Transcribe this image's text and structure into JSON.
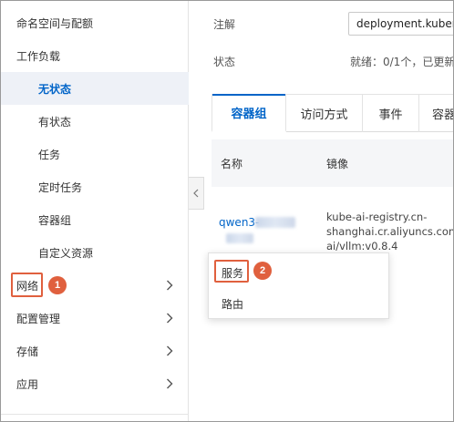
{
  "sidebar": {
    "items": [
      {
        "label": "命名空间与配额"
      },
      {
        "label": "工作负载"
      },
      {
        "label": "无状态"
      },
      {
        "label": "有状态"
      },
      {
        "label": "任务"
      },
      {
        "label": "定时任务"
      },
      {
        "label": "容器组"
      },
      {
        "label": "自定义资源"
      },
      {
        "label": "网络"
      },
      {
        "label": "配置管理"
      },
      {
        "label": "存储"
      },
      {
        "label": "应用"
      }
    ]
  },
  "steps": {
    "network": "1",
    "service": "2"
  },
  "details": {
    "annotation_label": "注解",
    "annotation_value": "deployment.kubernetes",
    "status_label": "状态",
    "status_value": "就绪：0/1个，已更新：1个"
  },
  "tabs": [
    {
      "label": "容器组"
    },
    {
      "label": "访问方式"
    },
    {
      "label": "事件"
    },
    {
      "label": "容器"
    }
  ],
  "table": {
    "headers": {
      "name": "名称",
      "image": "镜像"
    },
    "rows": [
      {
        "name": "qwen3-",
        "image": "kube-ai-registry.cn-shanghai.cr.aliyuncs.com/kube-ai/vllm:v0.8.4"
      }
    ]
  },
  "popup_menu": {
    "items": [
      {
        "label": "服务"
      },
      {
        "label": "路由"
      }
    ]
  },
  "colors": {
    "accent": "#0064c8",
    "highlight": "#e0603e",
    "active_bg": "#eef1f7"
  }
}
